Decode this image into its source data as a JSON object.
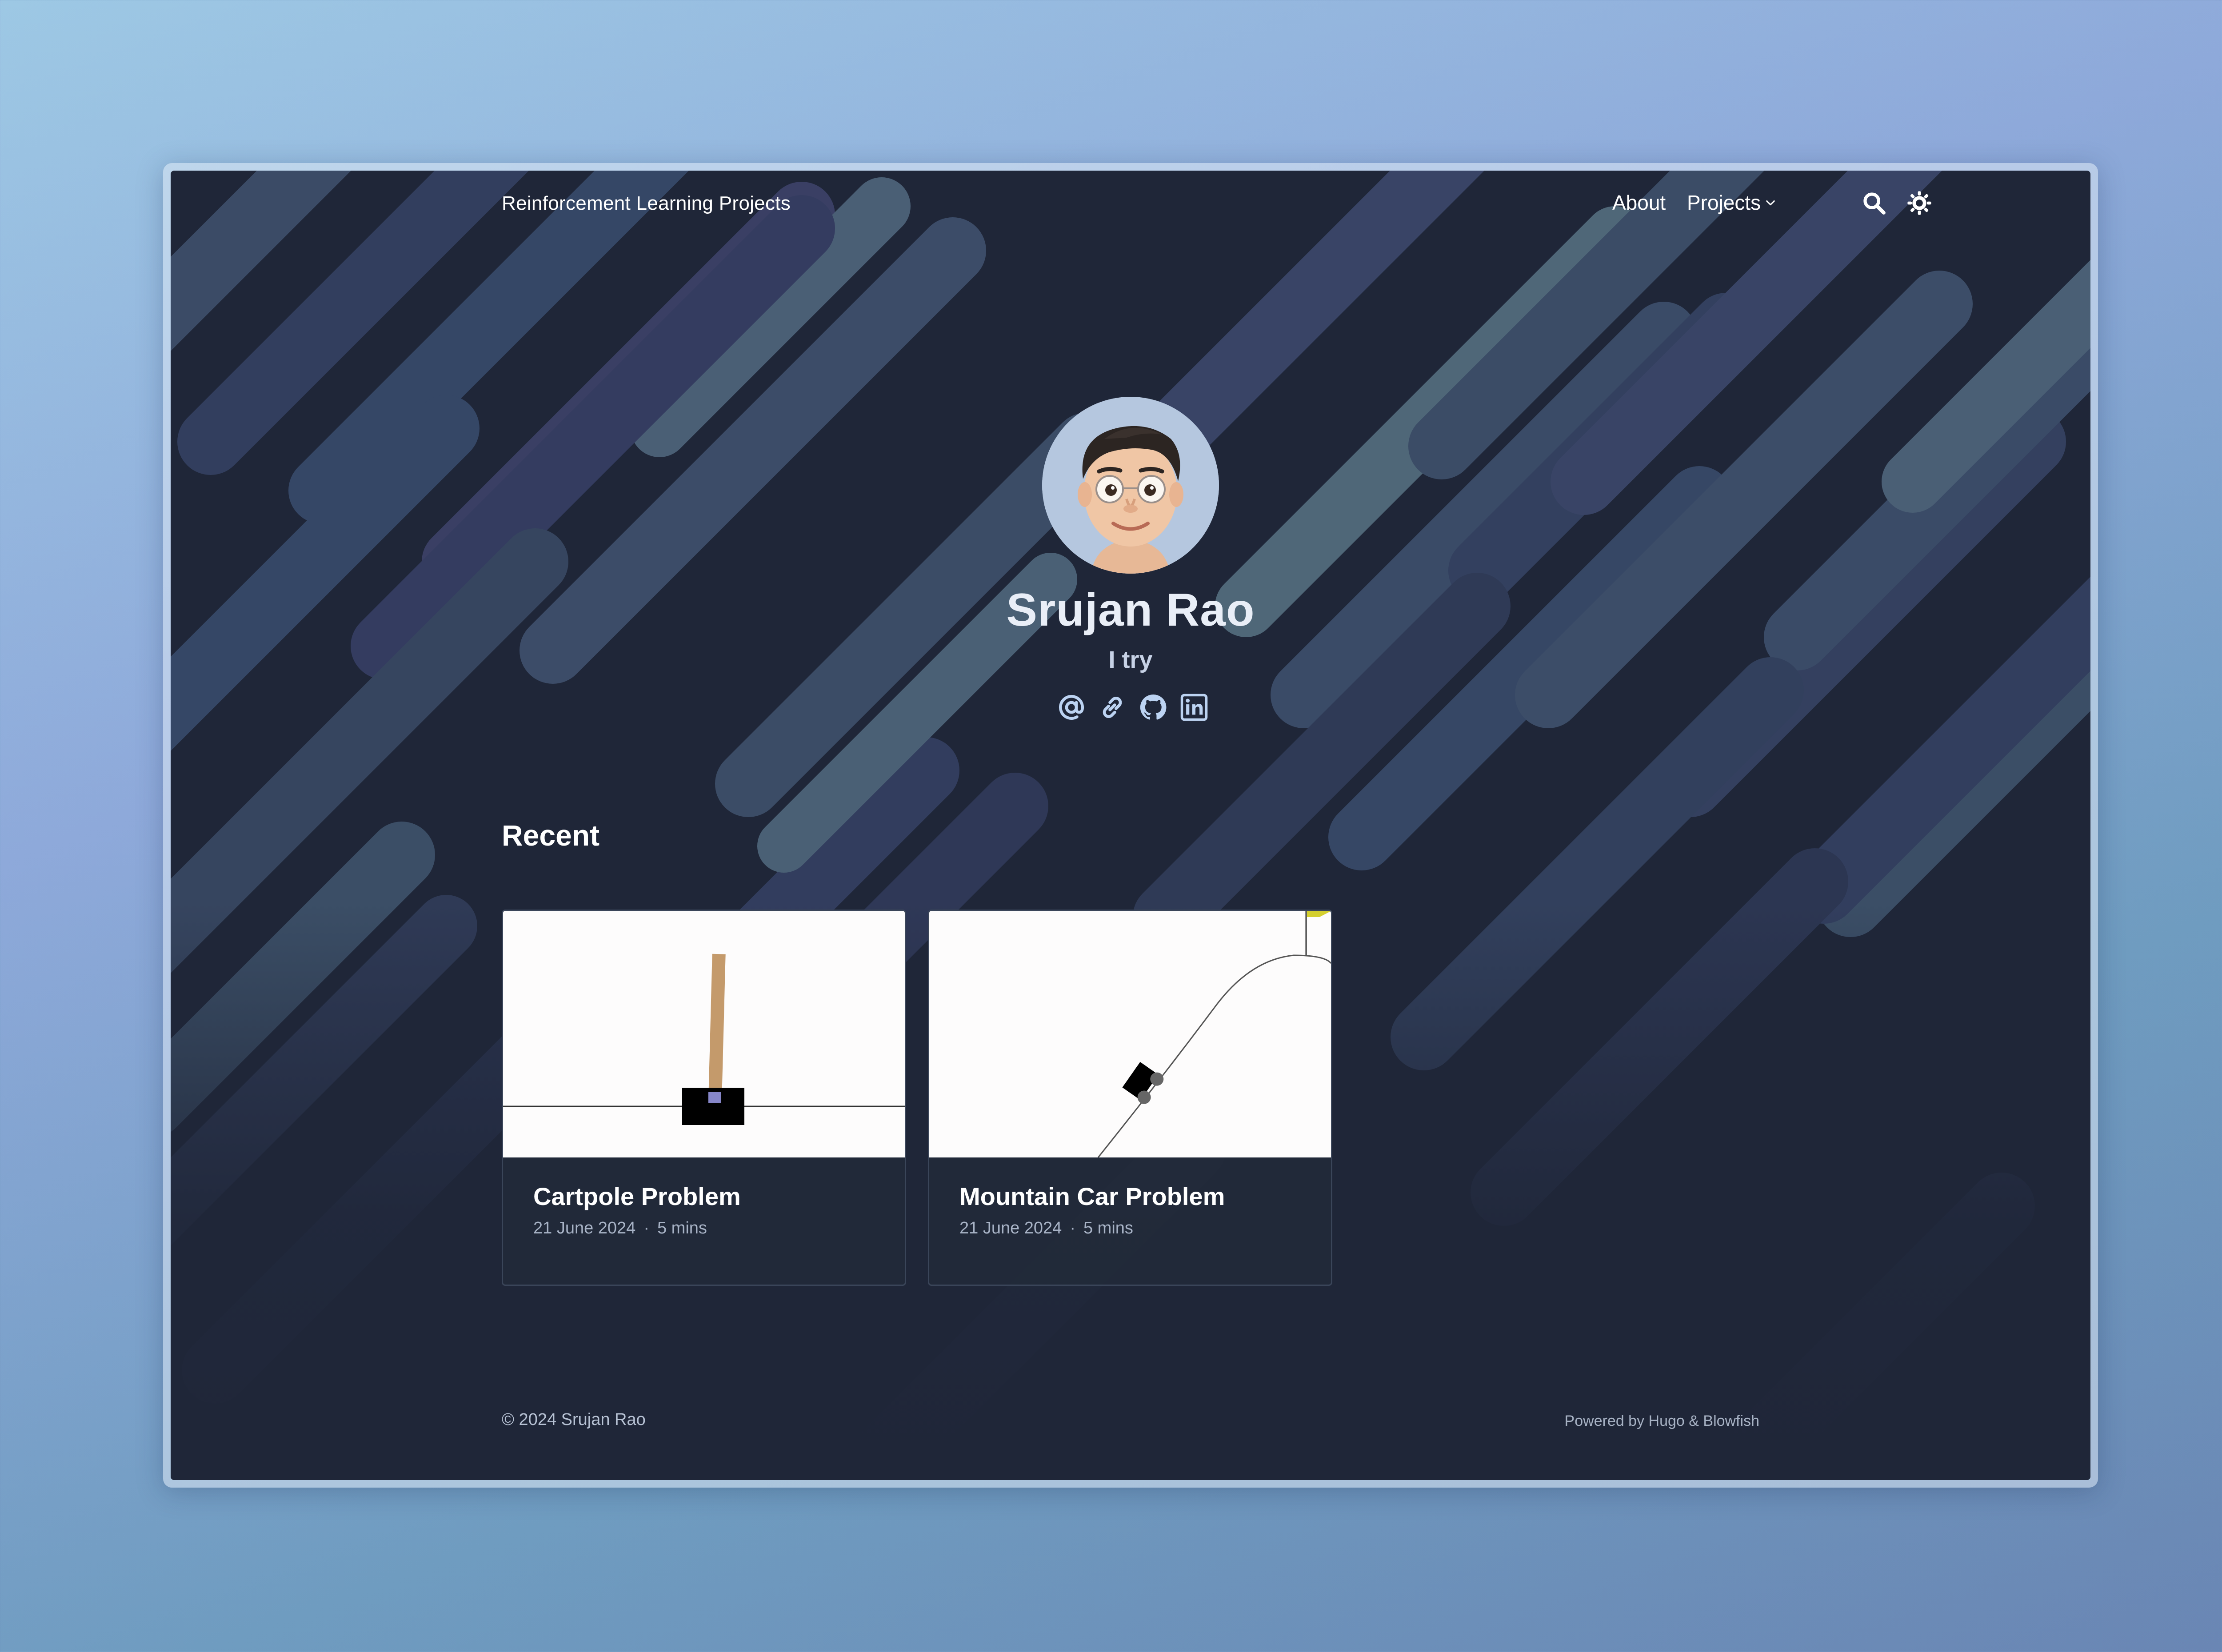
{
  "header": {
    "site_title": "Reinforcement Learning Projects",
    "nav": {
      "about": "About",
      "projects": "Projects"
    },
    "icons": [
      "search-icon",
      "appearance-toggle-icon"
    ]
  },
  "profile": {
    "name": "Srujan Rao",
    "tagline": "I try",
    "socials": [
      "email-icon",
      "link-icon",
      "github-icon",
      "linkedin-icon"
    ]
  },
  "recent": {
    "heading": "Recent",
    "articles": [
      {
        "title": "Cartpole Problem",
        "date": "21 June 2024",
        "separator": "·",
        "reading_time": "5 mins"
      },
      {
        "title": "Mountain Car Problem",
        "date": "21 June 2024",
        "separator": "·",
        "reading_time": "5 mins"
      }
    ]
  },
  "footer": {
    "copyright": "© 2024 Srujan Rao",
    "powered_by": "Powered by Hugo & Blowfish"
  },
  "colors": {
    "page_bg": "#1f2638",
    "accent_icons": "#bcd3f2",
    "text": "#ffffff"
  }
}
